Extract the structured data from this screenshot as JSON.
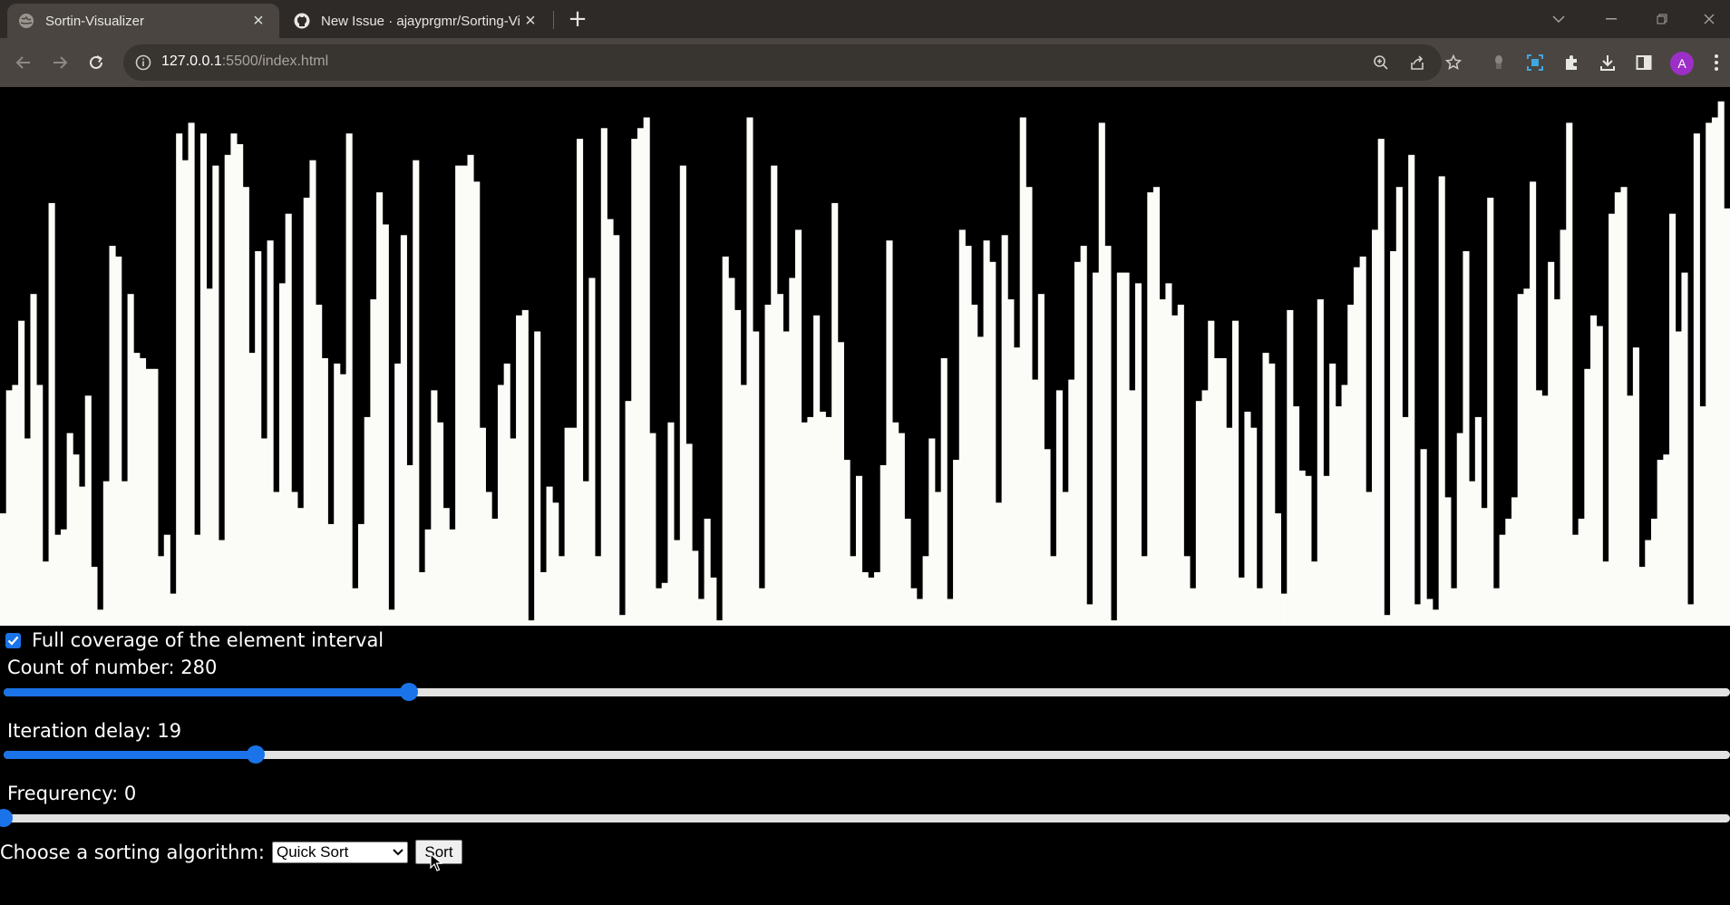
{
  "browser": {
    "tabs": [
      {
        "title": "Sortin-Visualizer",
        "icon": "globe-icon",
        "active": true
      },
      {
        "title": "New Issue · ajayprgmr/Sorting-Vi",
        "icon": "github-icon",
        "active": false
      }
    ],
    "address": {
      "host": "127.0.0.1",
      "rest": ":5500/index.html"
    },
    "profile_initial": "A"
  },
  "controls": {
    "coverage_label": "Full coverage of the element interval",
    "coverage_checked": true,
    "count_label": "Count of number: 280",
    "count_fraction": 0.235,
    "delay_label": "Iteration delay: 19",
    "delay_fraction": 0.146,
    "freq_label": "Frequrency: 0",
    "freq_fraction": 0.0,
    "algo_label": "Choose a sorting algorithm:",
    "algo_selected": "Quick Sort",
    "sort_label": "Sort"
  },
  "colors": {
    "accent": "#1a73e8",
    "bar": "#fbfbf7",
    "background": "#000000"
  },
  "chart_data": {
    "type": "bar",
    "note_values": "approximate bar heights as fraction of the visualizer's full height (1.0 = top), left to right; 280 bars",
    "values": [
      0.21,
      0.44,
      0.45,
      0.57,
      0.35,
      0.62,
      0.45,
      0.12,
      0.79,
      0.17,
      0.18,
      0.36,
      0.32,
      0.26,
      0.43,
      0.11,
      0.03,
      0.27,
      0.71,
      0.69,
      0.27,
      0.62,
      0.51,
      0.5,
      0.48,
      0.48,
      0.13,
      0.17,
      0.06,
      0.92,
      0.87,
      0.94,
      0.17,
      0.92,
      0.63,
      0.86,
      0.16,
      0.88,
      0.92,
      0.9,
      0.82,
      0.51,
      0.7,
      0.35,
      0.72,
      0.25,
      0.64,
      0.77,
      0.25,
      0.22,
      0.8,
      0.87,
      0.6,
      0.5,
      0.19,
      0.49,
      0.47,
      0.92,
      0.07,
      0.19,
      0.39,
      0.61,
      0.81,
      0.75,
      0.03,
      0.49,
      0.73,
      0.3,
      0.87,
      0.1,
      0.18,
      0.44,
      0.38,
      0.22,
      0.18,
      0.86,
      0.86,
      0.88,
      0.83,
      0.37,
      0.25,
      0.2,
      0.45,
      0.49,
      0.35,
      0.58,
      0.59,
      0.01,
      0.55,
      0.1,
      0.26,
      0.23,
      0.13,
      0.37,
      0.37,
      0.91,
      0.27,
      0.65,
      0.13,
      0.93,
      0.76,
      0.73,
      0.02,
      0.42,
      0.91,
      0.93,
      0.95,
      0.36,
      0.07,
      0.08,
      0.38,
      0.16,
      0.86,
      0.34,
      0.14,
      0.05,
      0.2,
      0.09,
      0.01,
      0.69,
      0.65,
      0.59,
      0.45,
      0.95,
      0.55,
      0.07,
      0.6,
      0.86,
      0.62,
      0.55,
      0.65,
      0.74,
      0.38,
      0.39,
      0.58,
      0.4,
      0.39,
      0.79,
      0.53,
      0.31,
      0.13,
      0.28,
      0.1,
      0.09,
      0.1,
      0.3,
      0.72,
      0.38,
      0.36,
      0.2,
      0.07,
      0.05,
      0.13,
      0.35,
      0.25,
      0.5,
      0.05,
      0.31,
      0.74,
      0.71,
      0.6,
      0.54,
      0.72,
      0.68,
      0.23,
      0.73,
      0.61,
      0.52,
      0.95,
      0.82,
      0.46,
      0.62,
      0.33,
      0.13,
      0.44,
      0.25,
      0.46,
      0.68,
      0.71,
      0.04,
      0.66,
      0.94,
      0.71,
      0.01,
      0.66,
      0.66,
      0.44,
      0.64,
      0.13,
      0.81,
      0.82,
      0.61,
      0.64,
      0.58,
      0.6,
      0.13,
      0.07,
      0.42,
      0.44,
      0.57,
      0.5,
      0.5,
      0.37,
      0.57,
      0.09,
      0.4,
      0.37,
      0.07,
      0.51,
      0.49,
      0.21,
      0.06,
      0.59,
      0.41,
      0.29,
      0.28,
      0.12,
      0.61,
      0.28,
      0.49,
      0.41,
      0.45,
      0.6,
      0.67,
      0.69,
      0.25,
      0.74,
      0.91,
      0.02,
      0.7,
      0.82,
      0.39,
      0.88,
      0.04,
      0.33,
      0.05,
      0.03,
      0.84,
      0.24,
      0.07,
      0.36,
      0.7,
      0.27,
      0.39,
      0.22,
      0.8,
      0.07,
      0.17,
      0.2,
      0.24,
      0.62,
      0.63,
      0.83,
      0.44,
      0.43,
      0.68,
      0.61,
      0.74,
      0.94,
      0.17,
      0.2,
      0.48,
      0.58,
      0.56,
      0.12,
      0.77,
      0.81,
      0.82,
      0.43,
      0.52,
      0.11,
      0.16,
      0.2,
      0.31,
      0.32,
      0.77,
      0.55,
      0.66,
      0.04,
      0.92,
      0.41,
      0.94,
      0.95,
      0.98,
      0.78
    ]
  }
}
